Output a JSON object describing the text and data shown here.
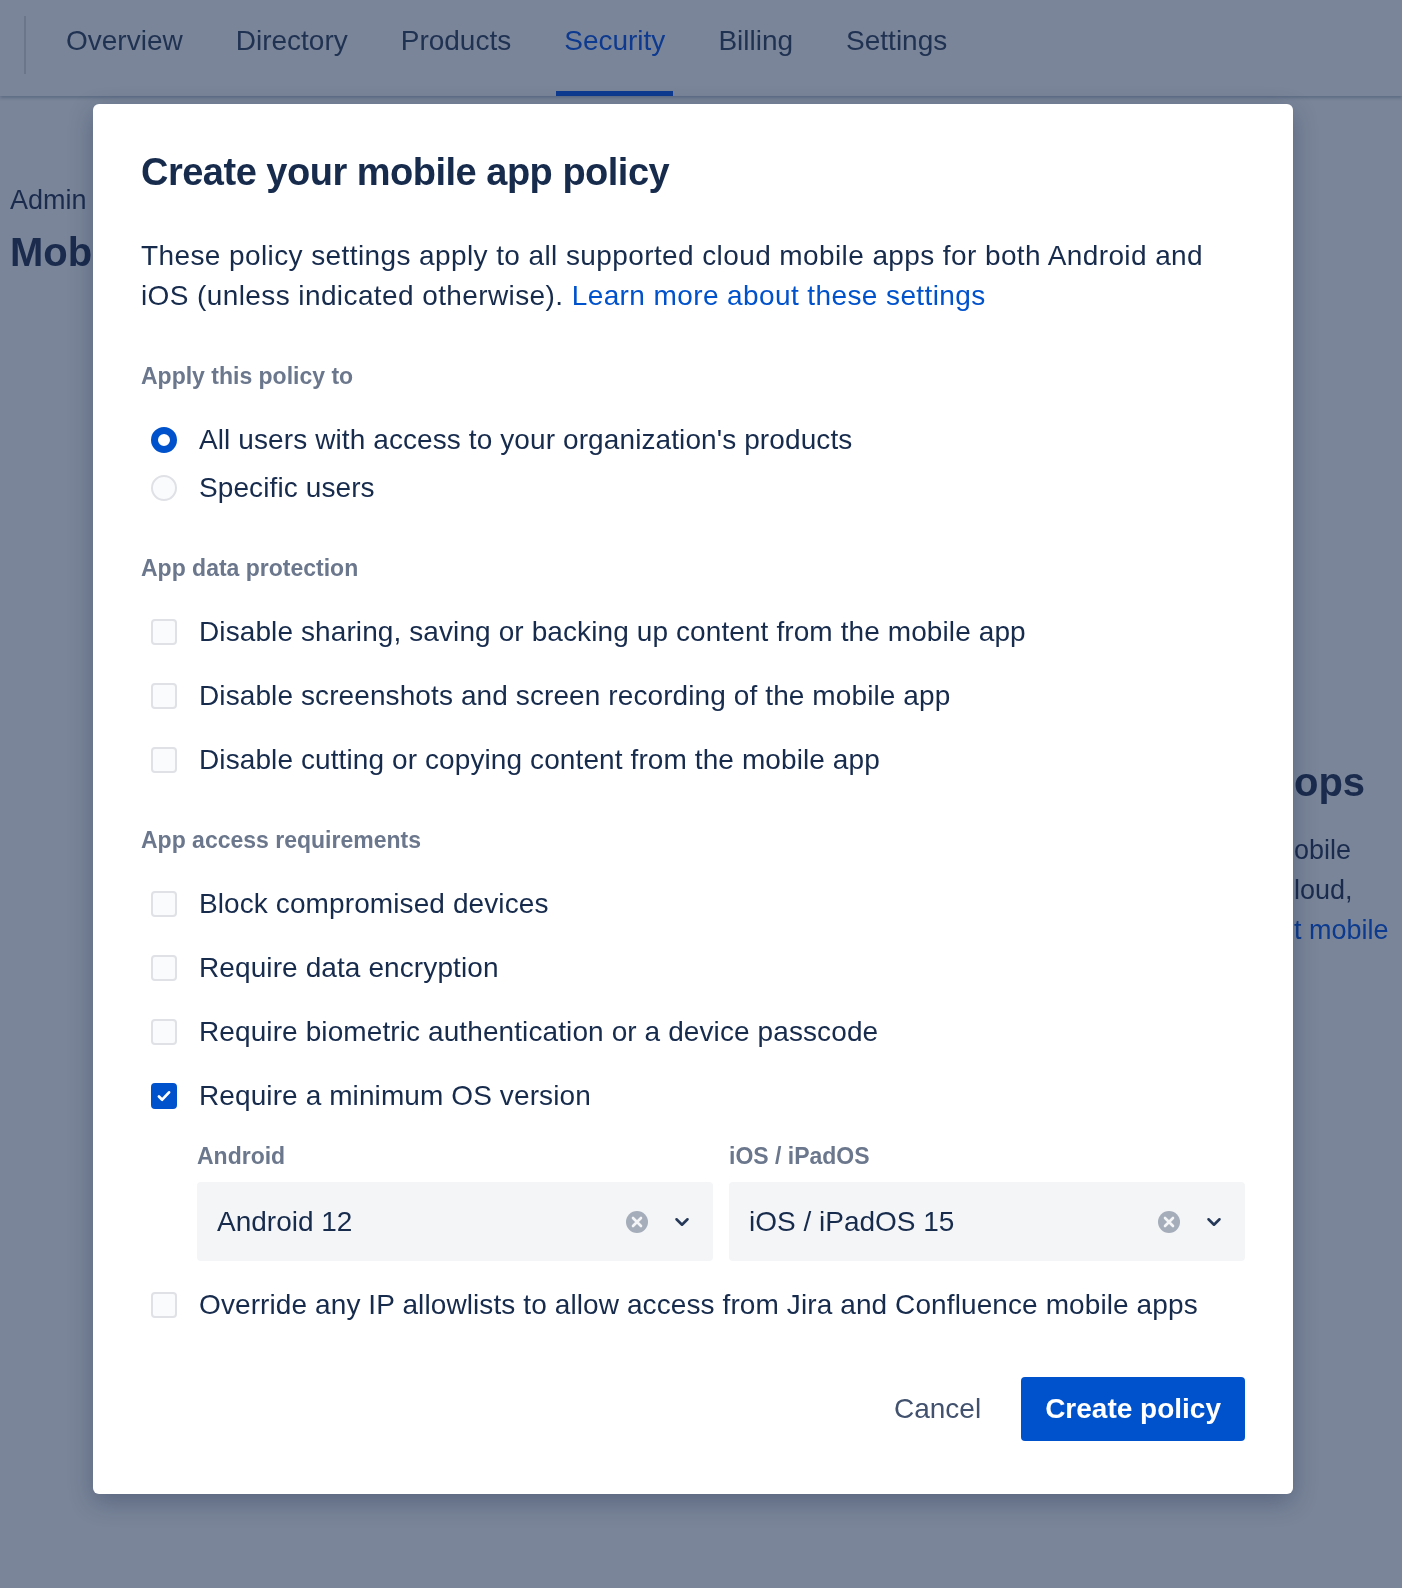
{
  "nav": {
    "tabs": [
      {
        "label": "Overview",
        "selected": false
      },
      {
        "label": "Directory",
        "selected": false
      },
      {
        "label": "Products",
        "selected": false
      },
      {
        "label": "Security",
        "selected": true
      },
      {
        "label": "Billing",
        "selected": false
      },
      {
        "label": "Settings",
        "selected": false
      }
    ]
  },
  "background_page": {
    "left": [
      {
        "kind": "breadcrumb",
        "text": "Admin"
      },
      {
        "kind": "heading",
        "text": "Mob"
      }
    ],
    "right": [
      {
        "kind": "heading",
        "text": "ops"
      },
      {
        "kind": "text",
        "text": "obile"
      },
      {
        "kind": "text",
        "text": "loud,"
      },
      {
        "kind": "link",
        "text": "t mobile"
      }
    ]
  },
  "dialog": {
    "title": "Create your mobile app policy",
    "intro": {
      "text": "These policy settings apply to all supported cloud mobile apps for both Android and iOS (unless indicated otherwise).",
      "link": "Learn more about these settings"
    },
    "sections": [
      {
        "label": "Apply this policy to",
        "kind": "radio",
        "options": [
          {
            "label": "All users with access to your organization's products",
            "selected": true
          },
          {
            "label": "Specific users",
            "selected": false
          }
        ]
      },
      {
        "label": "App data protection",
        "kind": "checkbox",
        "options": [
          {
            "label": "Disable sharing, saving or backing up content from the mobile app",
            "checked": false
          },
          {
            "label": "Disable screenshots and screen recording of the mobile app",
            "checked": false
          },
          {
            "label": "Disable cutting or copying content from the mobile app",
            "checked": false
          }
        ]
      },
      {
        "label": "App access requirements",
        "kind": "checkbox",
        "options": [
          {
            "label": "Block compromised devices",
            "checked": false
          },
          {
            "label": "Require data encryption",
            "checked": false
          },
          {
            "label": "Require biometric authentication or a device passcode",
            "checked": false
          },
          {
            "label": "Require a minimum OS version",
            "checked": true,
            "selects": [
              {
                "label": "Android",
                "value": "Android 12"
              },
              {
                "label": "iOS / iPadOS",
                "value": "iOS / iPadOS 15"
              }
            ]
          },
          {
            "label": "Override any IP allowlists to allow access from Jira and Confluence mobile apps",
            "checked": false
          }
        ]
      }
    ],
    "buttons": [
      {
        "label": "Cancel",
        "kind": "subtle"
      },
      {
        "label": "Create policy",
        "kind": "primary"
      }
    ]
  }
}
